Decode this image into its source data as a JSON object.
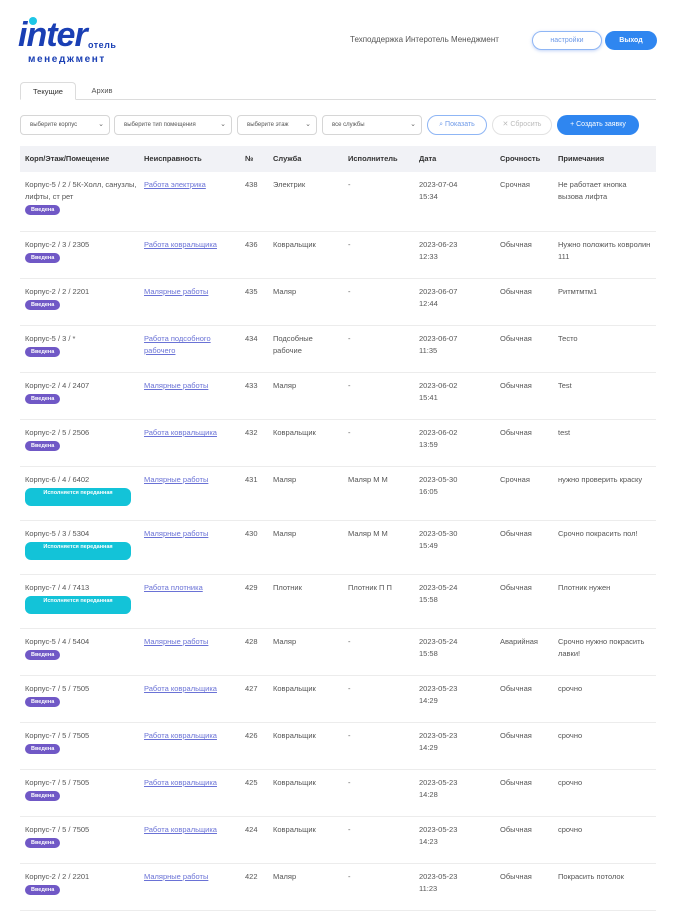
{
  "header": {
    "logo_inter": "inter",
    "logo_hotel": "отель",
    "logo_mgmt": "менеджмент",
    "support": "Техподдержка Интеротель Менеджмент",
    "settings": "настройки",
    "logout": "Выход"
  },
  "tabs": {
    "current": "Текущие",
    "archive": "Архив"
  },
  "filters": {
    "building": "выберите корпус",
    "room_type": "выберите тип помещения",
    "floor": "выберите этаж",
    "services": "все службы",
    "show": "Показать",
    "reset": "Сбросить",
    "create": "Создать заявку"
  },
  "columns": {
    "location": "Корп/Этаж/Помещение",
    "fault": "Неисправность",
    "num": "№",
    "service": "Служба",
    "executor": "Исполнитель",
    "date": "Дата",
    "urgency": "Срочность",
    "notes": "Примечания"
  },
  "rows": [
    {
      "location": "Корпус-5 / 2 / 5К-Холл, санузлы, лифты, ст рет",
      "status": "Введена",
      "fault": "Работа электрика",
      "num": "438",
      "service": "Электрик",
      "executor": "-",
      "date": "2023-07-04",
      "time": "15:34",
      "urgency": "Срочная",
      "notes": "Не работает кнопка вызова лифта"
    },
    {
      "location": "Корпус-2 / 3 / 2305",
      "status": "Введена",
      "fault": "Работа ковральщика",
      "num": "436",
      "service": "Ковральщик",
      "executor": "-",
      "date": "2023-06-23",
      "time": "12:33",
      "urgency": "Обычная",
      "notes": "Нужно положить ковролин 111"
    },
    {
      "location": "Корпус-2 / 2 / 2201",
      "status": "Введена",
      "fault": "Малярные работы",
      "num": "435",
      "service": "Маляр",
      "executor": "-",
      "date": "2023-06-07",
      "time": "12:44",
      "urgency": "Обычная",
      "notes": "Ритмтмтм1"
    },
    {
      "location": "Корпус-5 / 3 / *",
      "status": "Введена",
      "fault": "Работа подсобного рабочего",
      "num": "434",
      "service": "Подсобные рабочие",
      "executor": "-",
      "date": "2023-06-07",
      "time": "11:35",
      "urgency": "Обычная",
      "notes": "Тесто"
    },
    {
      "location": "Корпус-2 / 4 / 2407",
      "status": "Введена",
      "fault": "Малярные работы",
      "num": "433",
      "service": "Маляр",
      "executor": "-",
      "date": "2023-06-02",
      "time": "15:41",
      "urgency": "Обычная",
      "notes": "Test"
    },
    {
      "location": "Корпус-2 / 5 / 2506",
      "status": "Введена",
      "fault": "Работа ковральщика",
      "num": "432",
      "service": "Ковральщик",
      "executor": "-",
      "date": "2023-06-02",
      "time": "13:59",
      "urgency": "Обычная",
      "notes": "test"
    },
    {
      "location": "Корпус-6 / 4 / 6402",
      "status": "Исполняется переданная",
      "fault": "Малярные работы",
      "num": "431",
      "service": "Маляр",
      "executor": "Маляр М М",
      "date": "2023-05-30",
      "time": "16:05",
      "urgency": "Срочная",
      "notes": "нужно проверить краску"
    },
    {
      "location": "Корпус-5 / 3 / 5304",
      "status": "Исполняется переданная",
      "fault": "Малярные работы",
      "num": "430",
      "service": "Маляр",
      "executor": "Маляр М М",
      "date": "2023-05-30",
      "time": "15:49",
      "urgency": "Обычная",
      "notes": "Срочно покрасить пол!"
    },
    {
      "location": "Корпус-7 / 4 / 7413",
      "status": "Исполняется переданная",
      "fault": "Работа плотника",
      "num": "429",
      "service": "Плотник",
      "executor": "Плотник П П",
      "date": "2023-05-24",
      "time": "15:58",
      "urgency": "Обычная",
      "notes": "Плотник нужен"
    },
    {
      "location": "Корпус-5 / 4 / 5404",
      "status": "Введена",
      "fault": "Малярные работы",
      "num": "428",
      "service": "Маляр",
      "executor": "-",
      "date": "2023-05-24",
      "time": "15:58",
      "urgency": "Аварийная",
      "notes": "Срочно нужно покрасить лавки!"
    },
    {
      "location": "Корпус-7 / 5 / 7505",
      "status": "Введена",
      "fault": "Работа ковральщика",
      "num": "427",
      "service": "Ковральщик",
      "executor": "-",
      "date": "2023-05-23",
      "time": "14:29",
      "urgency": "Обычная",
      "notes": "срочно"
    },
    {
      "location": "Корпус-7 / 5 / 7505",
      "status": "Введена",
      "fault": "Работа ковральщика",
      "num": "426",
      "service": "Ковральщик",
      "executor": "-",
      "date": "2023-05-23",
      "time": "14:29",
      "urgency": "Обычная",
      "notes": "срочно"
    },
    {
      "location": "Корпус-7 / 5 / 7505",
      "status": "Введена",
      "fault": "Работа ковральщика",
      "num": "425",
      "service": "Ковральщик",
      "executor": "-",
      "date": "2023-05-23",
      "time": "14:28",
      "urgency": "Обычная",
      "notes": "срочно"
    },
    {
      "location": "Корпус-7 / 5 / 7505",
      "status": "Введена",
      "fault": "Работа ковральщика",
      "num": "424",
      "service": "Ковральщик",
      "executor": "-",
      "date": "2023-05-23",
      "time": "14:23",
      "urgency": "Обычная",
      "notes": "срочно"
    },
    {
      "location": "Корпус-2 / 2 / 2201",
      "status": "Введена",
      "fault": "Малярные работы",
      "num": "422",
      "service": "Маляр",
      "executor": "-",
      "date": "2023-05-23",
      "time": "11:23",
      "urgency": "Обычная",
      "notes": "Покрасить потолок"
    }
  ]
}
